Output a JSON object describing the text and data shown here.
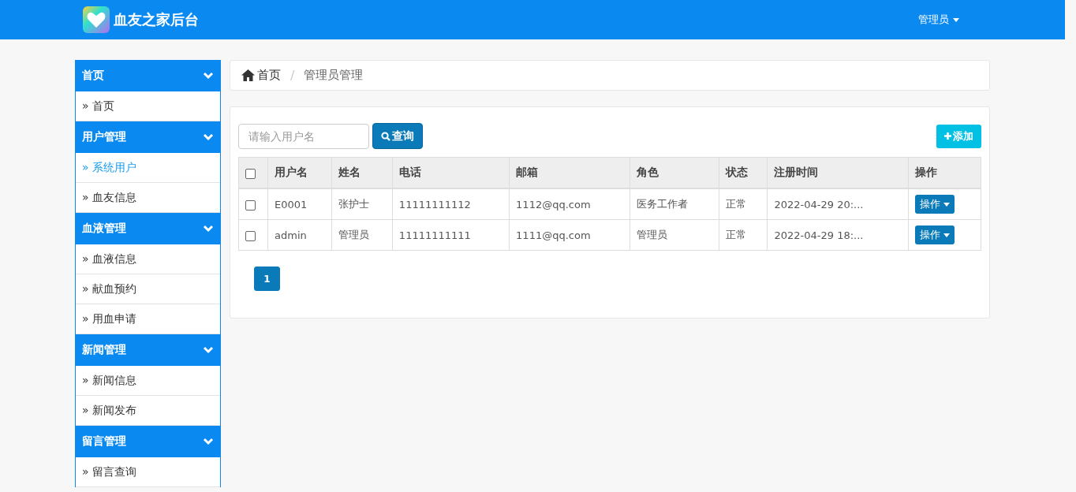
{
  "header": {
    "title": "血友之家后台",
    "user_menu": "管理员"
  },
  "sidebar": {
    "groups": [
      {
        "title": "首页",
        "expanded": true,
        "items": [
          {
            "label": "» 首页",
            "selected": false
          }
        ]
      },
      {
        "title": "用户管理",
        "expanded": true,
        "items": [
          {
            "label": "» 系统用户",
            "selected": true
          },
          {
            "label": "» 血友信息",
            "selected": false
          }
        ]
      },
      {
        "title": "血液管理",
        "expanded": true,
        "items": [
          {
            "label": "» 血液信息",
            "selected": false
          },
          {
            "label": "» 献血预约",
            "selected": false
          },
          {
            "label": "» 用血申请",
            "selected": false
          }
        ]
      },
      {
        "title": "新闻管理",
        "expanded": true,
        "items": [
          {
            "label": "» 新闻信息",
            "selected": false
          },
          {
            "label": "» 新闻发布",
            "selected": false
          }
        ]
      },
      {
        "title": "留言管理",
        "expanded": true,
        "items": [
          {
            "label": "» 留言查询",
            "selected": false
          }
        ]
      }
    ]
  },
  "breadcrumb": {
    "separator": "/",
    "items": [
      "首页",
      "管理员管理"
    ]
  },
  "search": {
    "placeholder": "请输入用户名",
    "button": "查询"
  },
  "add_button": "添加",
  "table": {
    "select_all": {
      "checked": false
    },
    "columns": [
      "用户名",
      "姓名",
      "电话",
      "邮箱",
      "角色",
      "状态",
      "注册时间",
      "操作"
    ],
    "rows": [
      {
        "checked": false,
        "cells": [
          "E0001",
          "张护士",
          "11111111112",
          "1112@qq.com",
          "医务工作者",
          "正常",
          "2022-04-29 20:..."
        ],
        "action": "操作"
      },
      {
        "checked": false,
        "cells": [
          "admin",
          "管理员",
          "11111111111",
          "1111@qq.com",
          "管理员",
          "正常",
          "2022-04-29 18:..."
        ],
        "action": "操作"
      }
    ]
  },
  "pagination": [
    {
      "label": "1",
      "selected": true
    }
  ]
}
